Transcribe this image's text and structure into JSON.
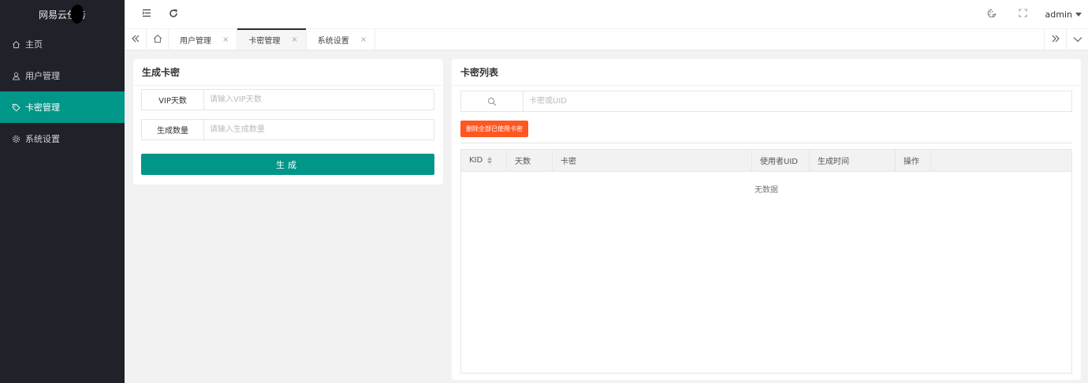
{
  "app": {
    "title": "网易云任务"
  },
  "sidebar": {
    "items": [
      {
        "label": "主页",
        "icon": "home-icon",
        "active": false
      },
      {
        "label": "用户管理",
        "icon": "user-icon",
        "active": false
      },
      {
        "label": "卡密管理",
        "icon": "tag-icon",
        "active": true
      },
      {
        "label": "系统设置",
        "icon": "gear-icon",
        "active": false
      }
    ]
  },
  "header": {
    "user": "admin",
    "icons": [
      "menu-fold-icon",
      "refresh-icon",
      "theme-icon",
      "fullscreen-icon"
    ]
  },
  "tabs": {
    "items": [
      {
        "label": "用户管理",
        "close": "×"
      },
      {
        "label": "卡密管理",
        "close": "×",
        "active": true
      },
      {
        "label": "系统设置",
        "close": "×"
      }
    ]
  },
  "generate": {
    "title": "生成卡密",
    "vip_days_label": "VIP天数",
    "vip_days_placeholder": "请输入VIP天数",
    "count_label": "生成数量",
    "count_placeholder": "请输入生成数量",
    "button": "生成"
  },
  "list": {
    "title": "卡密列表",
    "search_placeholder": "卡密或UID",
    "delete_button": "删除全部已使用卡密",
    "columns": [
      "KID",
      "天数",
      "卡密",
      "使用者UID",
      "生成时间",
      "操作"
    ],
    "empty": "无数据"
  },
  "colors": {
    "accent": "#009688",
    "danger": "#ff5722",
    "sidebar": "#20222a"
  }
}
